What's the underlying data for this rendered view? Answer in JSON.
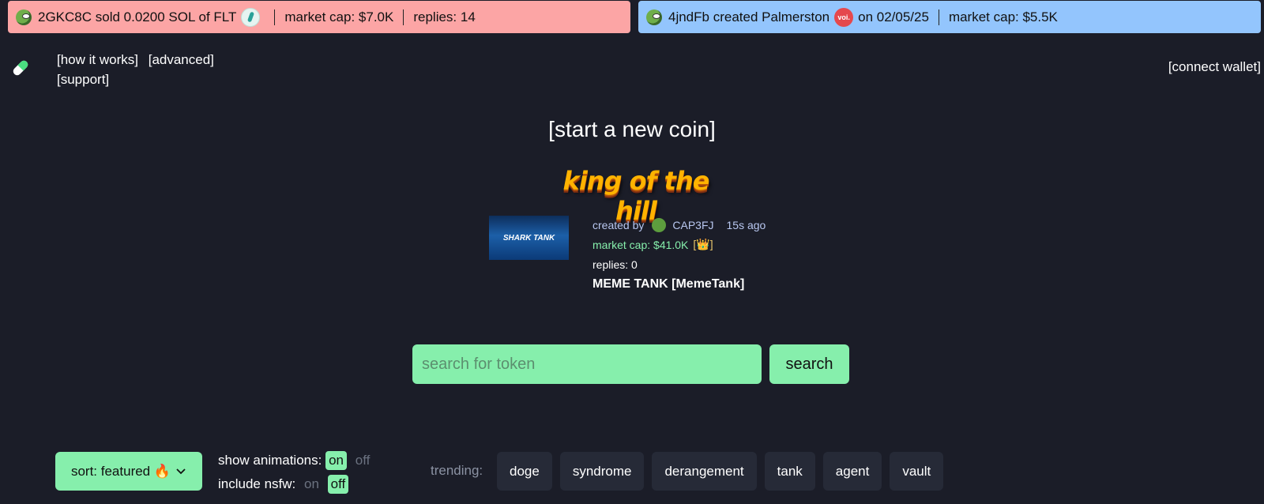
{
  "ticker_left": {
    "user": "2GKC8C",
    "action": "sold 0.0200 SOL of FLT",
    "market_cap": "market cap: $7.0K",
    "replies": "replies: 14"
  },
  "ticker_right": {
    "user": "4jndFb",
    "action": "created Palmerston",
    "token_icon_text": "voi.",
    "date": "on 02/05/25",
    "market_cap": "market cap: $5.5K"
  },
  "nav": {
    "how_it_works": "[how it works]",
    "advanced": "[advanced]",
    "support": "[support]",
    "socials": [
      "x-icon",
      "telegram-icon",
      "instagram-icon",
      "tiktok-icon"
    ],
    "connect_wallet": "[connect wallet]"
  },
  "start_coin": "[start a new coin]",
  "king": {
    "banner": "king of the hill",
    "image_text": "SHARK TANK",
    "created_by": "created by",
    "creator": "CAP3FJ",
    "age": "15s ago",
    "market_cap": "market cap: $41.0K",
    "crown_icon": "crown-icon",
    "replies": "replies: 0",
    "name": "MEME TANK [MemeTank]"
  },
  "search": {
    "placeholder": "search for token",
    "button": "search"
  },
  "controls": {
    "sort": "sort: featured 🔥",
    "show_animations": "show animations:",
    "include_nsfw": "include nsfw:",
    "on": "on",
    "off": "off",
    "trending_label": "trending:",
    "trending": [
      "doge",
      "syndrome",
      "derangement",
      "tank",
      "agent",
      "vault"
    ]
  },
  "colors": {
    "background": "#1b1d28",
    "accent_green": "#86efac",
    "ticker_red": "#fca5a5",
    "ticker_blue": "#93c5fd"
  }
}
